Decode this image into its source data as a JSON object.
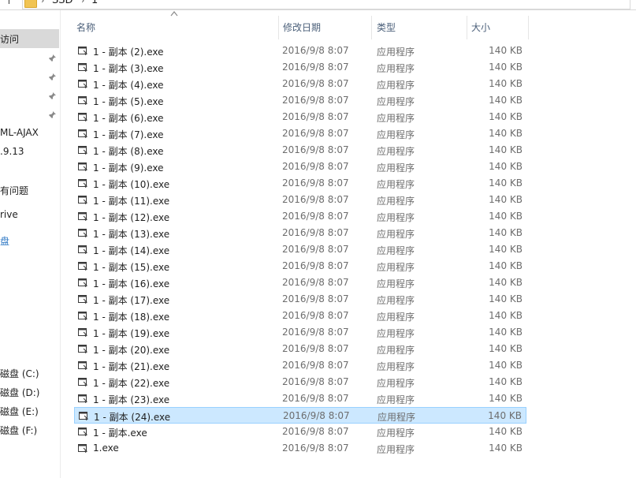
{
  "address": {
    "crumbs": [
      "SSD",
      "1"
    ]
  },
  "nav": {
    "selected_label": "访问",
    "items": [
      "ML-AJAX",
      ".9.13",
      "有问题",
      "rive",
      "盘",
      "磁盘 (C:)",
      "磁盘 (D:)",
      "磁盘 (E:)",
      "磁盘 (F:)"
    ]
  },
  "columns": {
    "name": "名称",
    "date": "修改日期",
    "type": "类型",
    "size": "大小"
  },
  "files": [
    {
      "name": "1 - 副本 (2).exe",
      "date": "2016/9/8 8:07",
      "type": "应用程序",
      "size": "140 KB"
    },
    {
      "name": "1 - 副本 (3).exe",
      "date": "2016/9/8 8:07",
      "type": "应用程序",
      "size": "140 KB"
    },
    {
      "name": "1 - 副本 (4).exe",
      "date": "2016/9/8 8:07",
      "type": "应用程序",
      "size": "140 KB"
    },
    {
      "name": "1 - 副本 (5).exe",
      "date": "2016/9/8 8:07",
      "type": "应用程序",
      "size": "140 KB"
    },
    {
      "name": "1 - 副本 (6).exe",
      "date": "2016/9/8 8:07",
      "type": "应用程序",
      "size": "140 KB"
    },
    {
      "name": "1 - 副本 (7).exe",
      "date": "2016/9/8 8:07",
      "type": "应用程序",
      "size": "140 KB"
    },
    {
      "name": "1 - 副本 (8).exe",
      "date": "2016/9/8 8:07",
      "type": "应用程序",
      "size": "140 KB"
    },
    {
      "name": "1 - 副本 (9).exe",
      "date": "2016/9/8 8:07",
      "type": "应用程序",
      "size": "140 KB"
    },
    {
      "name": "1 - 副本 (10).exe",
      "date": "2016/9/8 8:07",
      "type": "应用程序",
      "size": "140 KB"
    },
    {
      "name": "1 - 副本 (11).exe",
      "date": "2016/9/8 8:07",
      "type": "应用程序",
      "size": "140 KB"
    },
    {
      "name": "1 - 副本 (12).exe",
      "date": "2016/9/8 8:07",
      "type": "应用程序",
      "size": "140 KB"
    },
    {
      "name": "1 - 副本 (13).exe",
      "date": "2016/9/8 8:07",
      "type": "应用程序",
      "size": "140 KB"
    },
    {
      "name": "1 - 副本 (14).exe",
      "date": "2016/9/8 8:07",
      "type": "应用程序",
      "size": "140 KB"
    },
    {
      "name": "1 - 副本 (15).exe",
      "date": "2016/9/8 8:07",
      "type": "应用程序",
      "size": "140 KB"
    },
    {
      "name": "1 - 副本 (16).exe",
      "date": "2016/9/8 8:07",
      "type": "应用程序",
      "size": "140 KB"
    },
    {
      "name": "1 - 副本 (17).exe",
      "date": "2016/9/8 8:07",
      "type": "应用程序",
      "size": "140 KB"
    },
    {
      "name": "1 - 副本 (18).exe",
      "date": "2016/9/8 8:07",
      "type": "应用程序",
      "size": "140 KB"
    },
    {
      "name": "1 - 副本 (19).exe",
      "date": "2016/9/8 8:07",
      "type": "应用程序",
      "size": "140 KB"
    },
    {
      "name": "1 - 副本 (20).exe",
      "date": "2016/9/8 8:07",
      "type": "应用程序",
      "size": "140 KB"
    },
    {
      "name": "1 - 副本 (21).exe",
      "date": "2016/9/8 8:07",
      "type": "应用程序",
      "size": "140 KB"
    },
    {
      "name": "1 - 副本 (22).exe",
      "date": "2016/9/8 8:07",
      "type": "应用程序",
      "size": "140 KB"
    },
    {
      "name": "1 - 副本 (23).exe",
      "date": "2016/9/8 8:07",
      "type": "应用程序",
      "size": "140 KB"
    },
    {
      "name": "1 - 副本 (24).exe",
      "date": "2016/9/8 8:07",
      "type": "应用程序",
      "size": "140 KB",
      "selected": true
    },
    {
      "name": "1 - 副本.exe",
      "date": "2016/9/8 8:07",
      "type": "应用程序",
      "size": "140 KB"
    },
    {
      "name": "1.exe",
      "date": "2016/9/8 8:07",
      "type": "应用程序",
      "size": "140 KB"
    }
  ],
  "colors": {
    "selection_bg": "#cce8ff",
    "selection_border": "#99d1ff",
    "header_text": "#4c607a"
  },
  "icons": {
    "file": "exe-file-icon",
    "pin": "pin-icon",
    "folder": "folder-icon"
  }
}
